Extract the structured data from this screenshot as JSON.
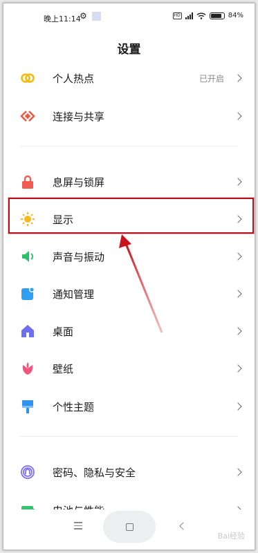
{
  "status_bar": {
    "time": "晚上11:14",
    "battery": "84%",
    "battery_level": 0.84
  },
  "header": {
    "title": "设置"
  },
  "rows": [
    {
      "id": "hotspot",
      "label": "个人热点",
      "value": "已开启",
      "icon": "hotspot-icon",
      "color": "#f5b90f"
    },
    {
      "id": "connection",
      "label": "连接与共享",
      "value": "",
      "icon": "connection-share-icon",
      "color": "#ee5a45"
    },
    {
      "id": "lockscreen",
      "label": "息屏与锁屏",
      "value": "",
      "icon": "lock-icon",
      "color": "#f25b50"
    },
    {
      "id": "display",
      "label": "显示",
      "value": "",
      "icon": "sun-icon",
      "color": "#f8b81c"
    },
    {
      "id": "sound",
      "label": "声音与振动",
      "value": "",
      "icon": "speaker-icon",
      "color": "#29c26a"
    },
    {
      "id": "notifications",
      "label": "通知管理",
      "value": "",
      "icon": "notification-icon",
      "color": "#2e9ff5"
    },
    {
      "id": "desktop",
      "label": "桌面",
      "value": "",
      "icon": "home-icon",
      "color": "#6b6ff0"
    },
    {
      "id": "wallpaper",
      "label": "壁纸",
      "value": "",
      "icon": "flower-icon",
      "color": "#f2557a"
    },
    {
      "id": "theme",
      "label": "个性主题",
      "value": "",
      "icon": "paint-brush-icon",
      "color": "#2e93f0"
    },
    {
      "id": "security",
      "label": "密码、隐私与安全",
      "value": "",
      "icon": "fingerprint-icon",
      "color": "#7b6ef2"
    },
    {
      "id": "battery",
      "label": "电池与性能",
      "value": "",
      "icon": "battery-icon",
      "color": "#2fc56a"
    }
  ]
}
